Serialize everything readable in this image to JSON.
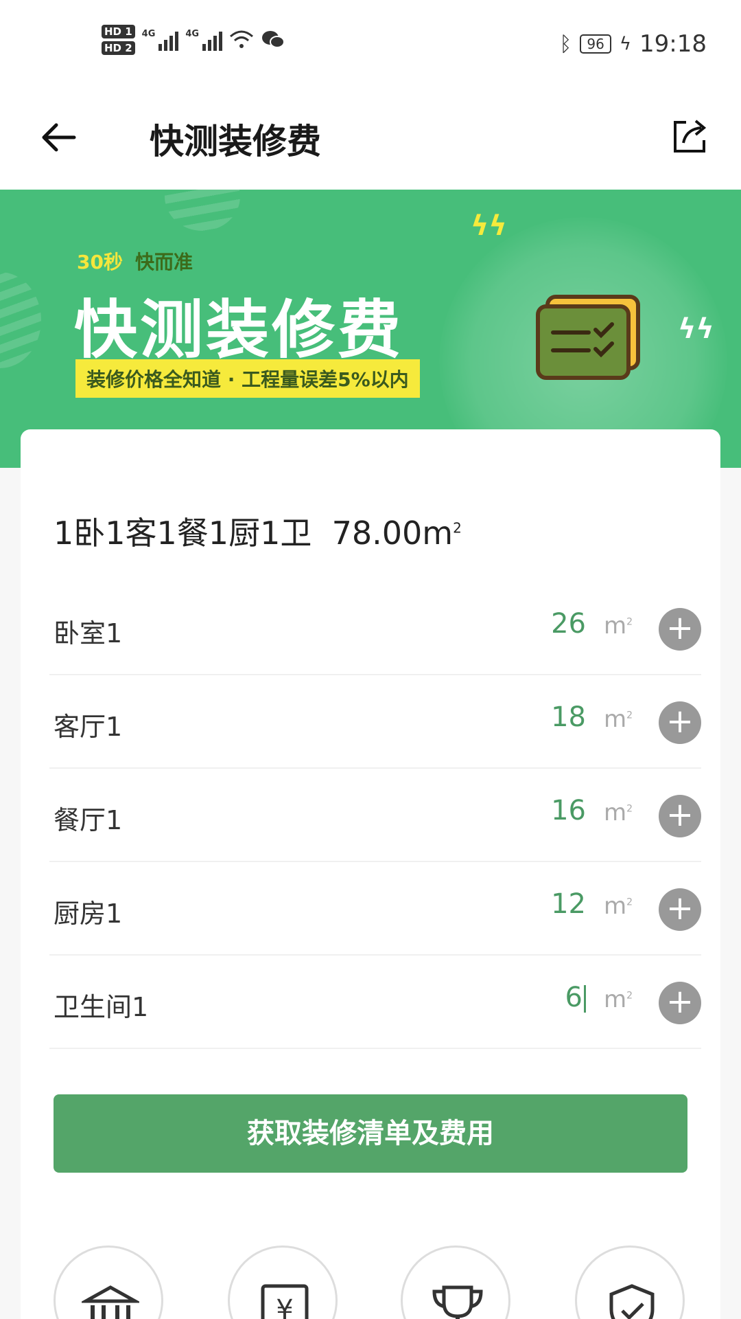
{
  "status_bar": {
    "hd1": "HD 1",
    "hd2": "HD 2",
    "net1": "4G",
    "net2": "4G",
    "battery": "96",
    "time": "19:18"
  },
  "app_bar": {
    "title": "快测装修费"
  },
  "banner": {
    "tag_seconds": "30秒",
    "tag_fast": "快而准",
    "headline": "快测装修费",
    "subline": "装修价格全知道 · 工程量误差5%以内"
  },
  "summary": {
    "layout": "1卧1客1餐1厨1卫",
    "area": "78.00m",
    "area_sup": "2"
  },
  "rooms": [
    {
      "name": "卧室1",
      "value": "26",
      "unit": "m",
      "unit_sup": "2"
    },
    {
      "name": "客厅1",
      "value": "18",
      "unit": "m",
      "unit_sup": "2"
    },
    {
      "name": "餐厅1",
      "value": "16",
      "unit": "m",
      "unit_sup": "2"
    },
    {
      "name": "厨房1",
      "value": "12",
      "unit": "m",
      "unit_sup": "2"
    },
    {
      "name": "卫生间1",
      "value": "6",
      "unit": "m",
      "unit_sup": "2"
    }
  ],
  "add_icon": "+",
  "cta_label": "获取装修清单及费用",
  "colors": {
    "brand_green": "#47be7a",
    "button_green": "#54a569",
    "value_green": "#4a9a64",
    "banner_yellow": "#f6ea3c"
  },
  "icons": [
    "back-arrow-icon",
    "share-icon",
    "bank-icon",
    "yuan-doc-icon",
    "trophy-icon",
    "shield-check-icon"
  ]
}
